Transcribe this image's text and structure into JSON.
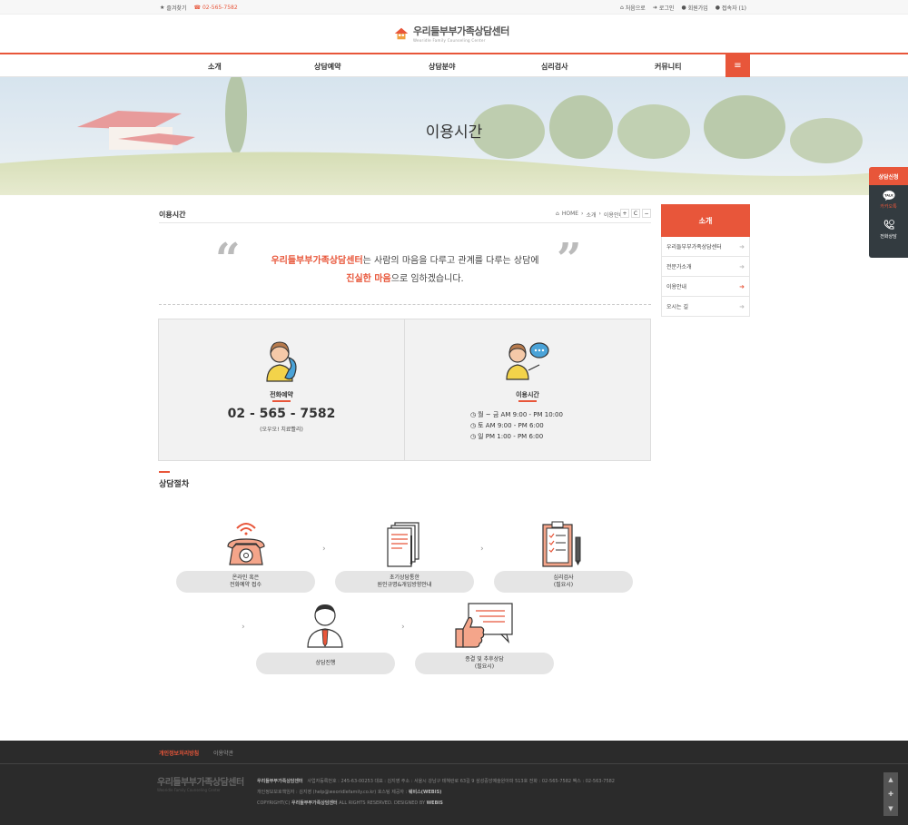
{
  "topbar": {
    "bookmark": "즐겨찾기",
    "phone": "02-565-7582",
    "home": "처음으로",
    "login": "로그인",
    "join": "회원가입",
    "visitors": "접속자 (1)"
  },
  "header": {
    "logo_title": "우리들부부가족상담센터",
    "logo_sub": "Weoridle Family Counseling Center"
  },
  "nav": {
    "items": [
      "소개",
      "상담예약",
      "상담분야",
      "심리검사",
      "커뮤니티"
    ]
  },
  "hero": {
    "title": "이용시간"
  },
  "quick": {
    "head": "상담신청",
    "kakao_badge": "TALK",
    "kakao": "카카오톡",
    "phone": "전화상담"
  },
  "page": {
    "title": "이용시간",
    "crumb_home": "HOME",
    "crumb_1": "소개",
    "crumb_2": "이용안내",
    "tool_plus": "+",
    "tool_reset": "C",
    "tool_minus": "−"
  },
  "quote": {
    "center": "우리들부부가족상담센터",
    "text1": "는 사람의 마음을 다루고 관계를 다루는 상담에",
    "emph": "진실한 마음",
    "text2": "으로 임하겠습니다."
  },
  "info": {
    "phone_label": "전화예약",
    "phone_number": "02 - 565 - 7582",
    "phone_note": "(오우오! 치료빨리)",
    "hours_label": "이용시간",
    "hours": [
      "월 ~ 금 AM 9:00 - PM 10:00",
      "토 AM 9:00 - PM 6:00",
      "일 PM 1:00 - PM 6:00"
    ]
  },
  "process": {
    "title": "상담절차",
    "steps": [
      {
        "l1": "온라인 혹은",
        "l2": "전화예약 접수"
      },
      {
        "l1": "초기상담통한",
        "l2": "원인규명&개입방향안내"
      },
      {
        "l1": "심리검사",
        "l2": "(필요시)"
      },
      {
        "l1": "상담진행",
        "l2": ""
      },
      {
        "l1": "종결 및 추후상담",
        "l2": "(필요시)"
      }
    ]
  },
  "sidebar": {
    "head": "소개",
    "items": [
      "우리들부부가족상담센터",
      "전문가소개",
      "이용안내",
      "오시는 길"
    ]
  },
  "footer": {
    "privacy": "개인정보처리방침",
    "terms": "이용약관",
    "logo_title": "우리들부부가족상담센터",
    "logo_sub": "Weoridle Family Counseling Center",
    "name": "우리들부부가족상담센터",
    "line1": "사업자등록번호 : 245-63-00253   대표 : 김지영   주소 : 서울시 강남구 테헤란로 63길 9 삼성중앙예술원아파 513호   전화 : 02-565-7582   팩스 : 02-563-7582",
    "line2": "개인정보보호책임자 : 김지영 (help@weoridlefamily.co.kr)   호스팅 제공자 :",
    "hosting": "웨비스(WEBIS)",
    "copy1": "COPYRIGHT(C)",
    "copy_name": "우리들부부가족상담센터",
    "copy2": "ALL RIGHTS RESERVED. DESIGNED BY",
    "copy_by": "WEBIS"
  },
  "colors": {
    "accent": "#e8563a",
    "footer_bg": "#2b2b2b",
    "box_bg": "#f2f2f2"
  }
}
